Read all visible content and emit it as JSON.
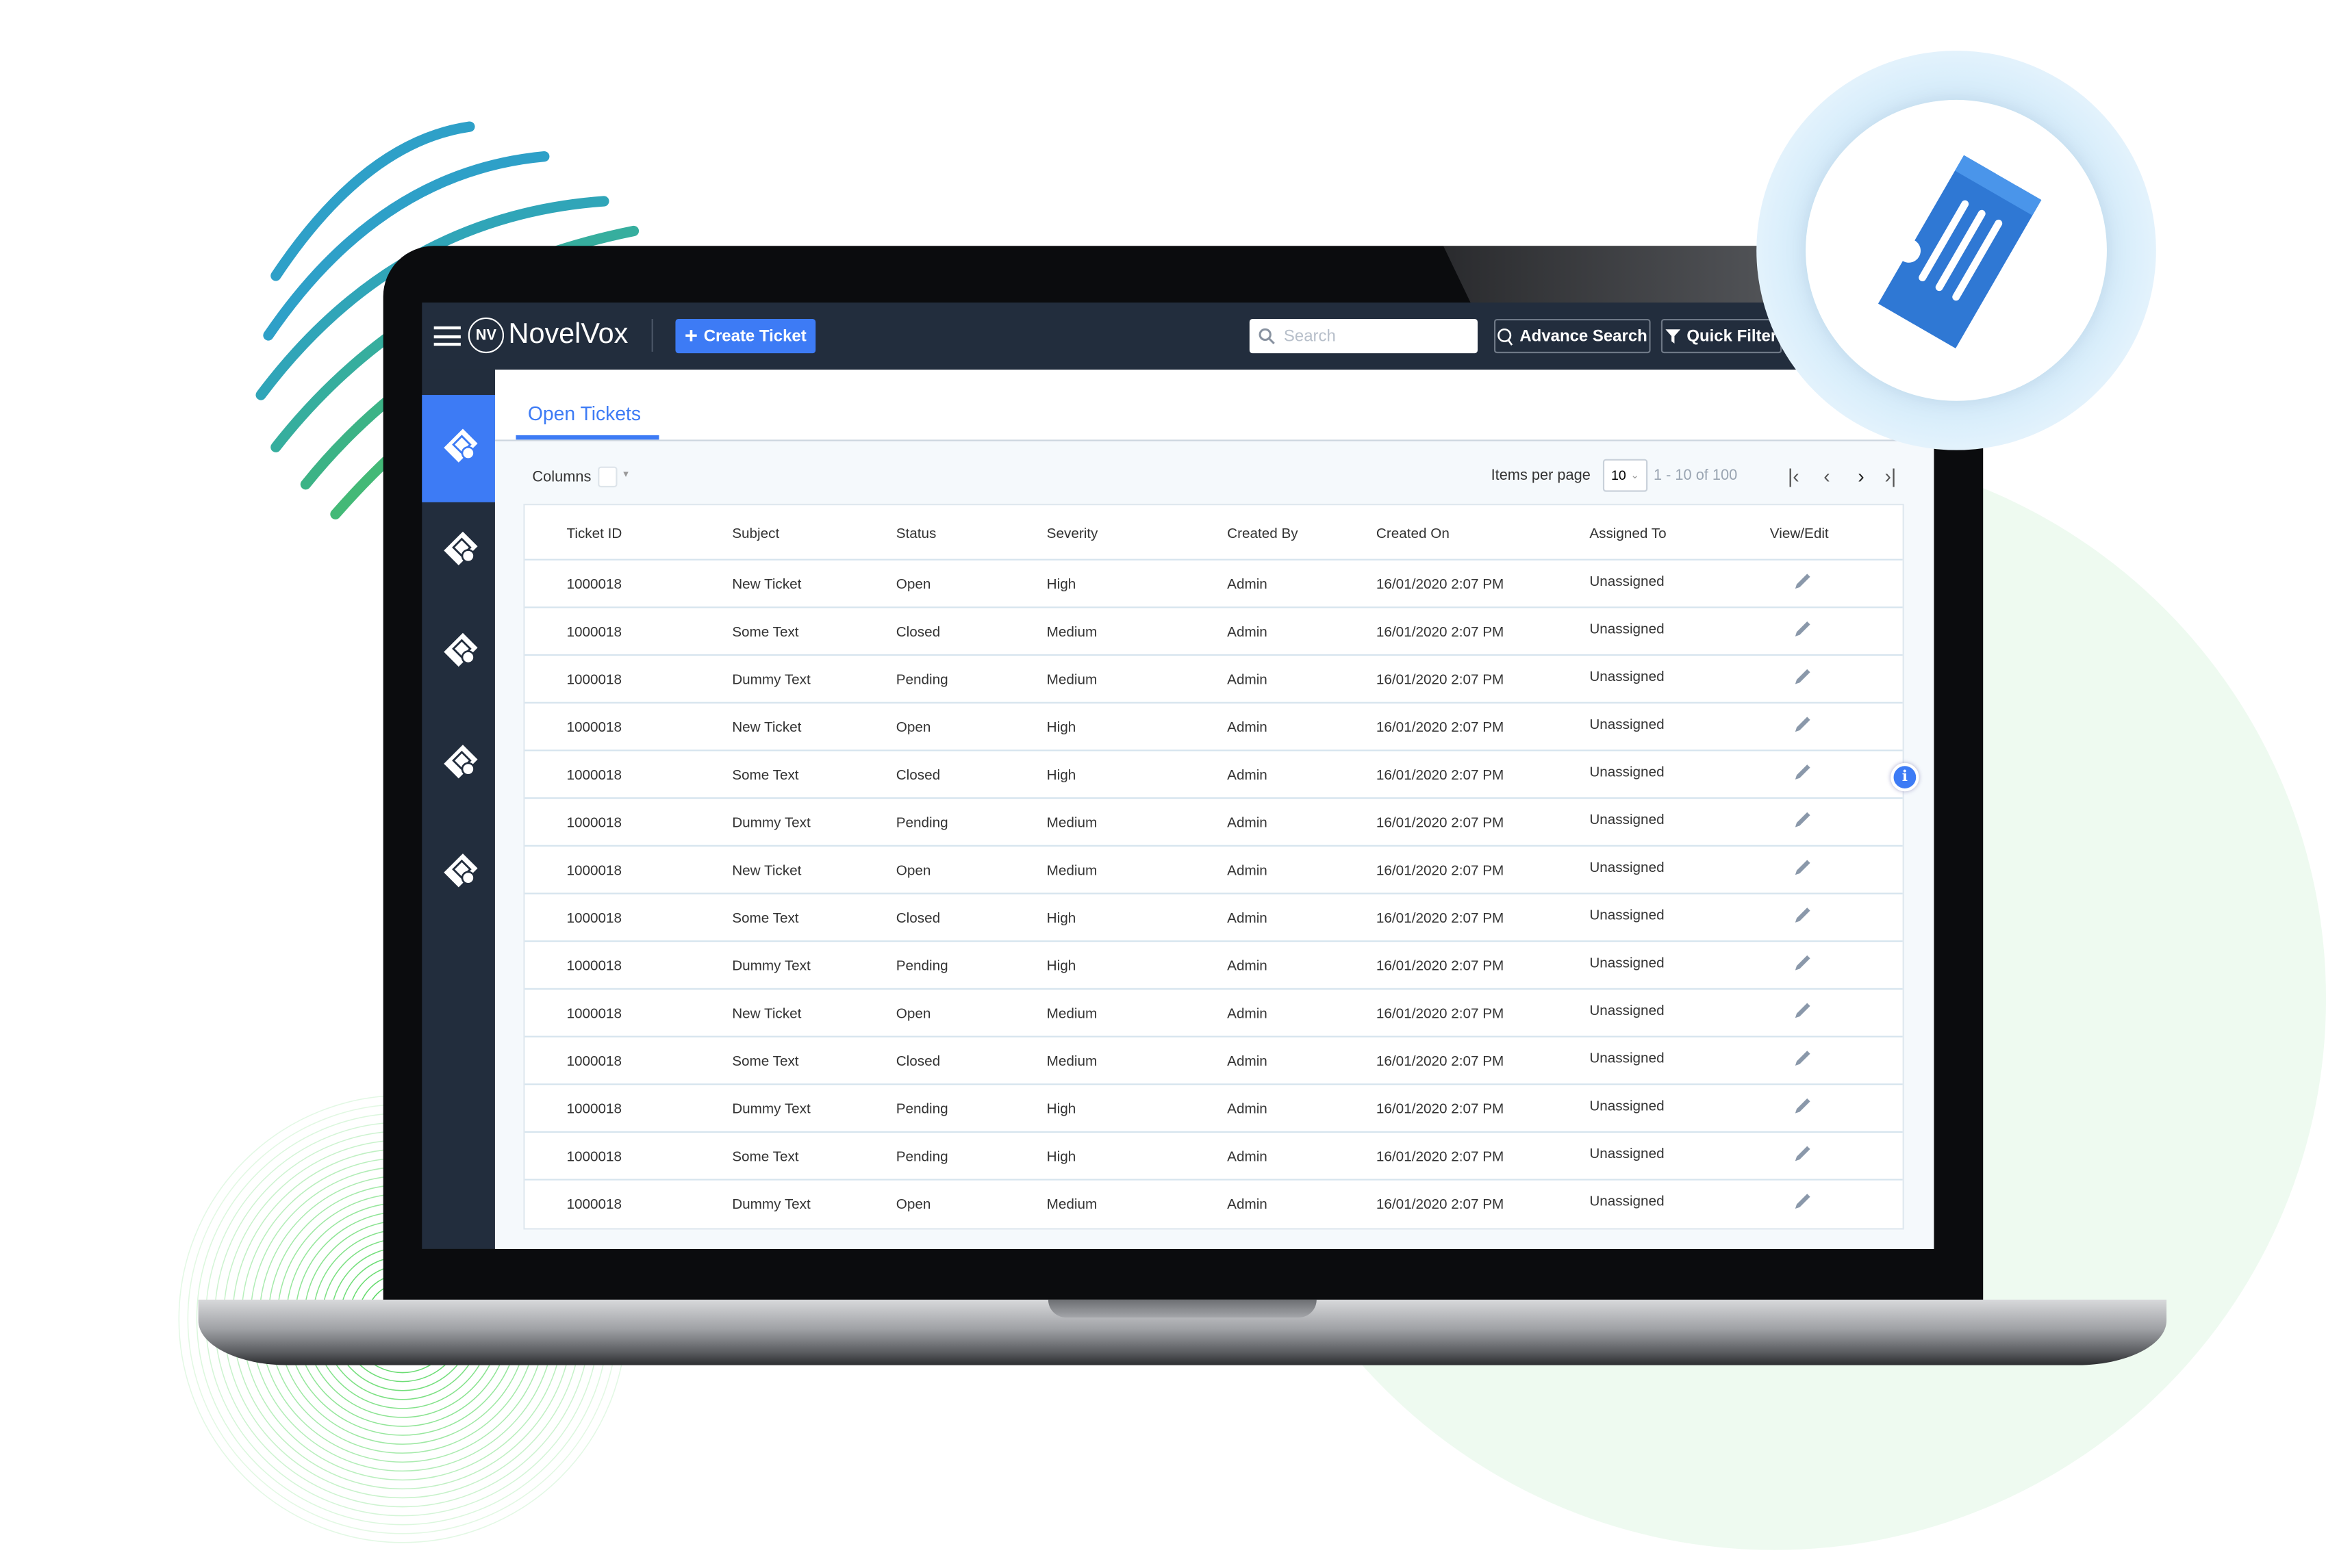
{
  "app": {
    "brand": "NovelVox",
    "logo_text": "NV",
    "create_ticket": "Create Ticket",
    "search_placeholder": "Search",
    "advance_search": "Advance Search",
    "quick_filter": "Quick Filter"
  },
  "tabs": [
    {
      "label": "Open Tickets",
      "active": true
    }
  ],
  "toolbar": {
    "columns_label": "Columns",
    "items_per_page_label": "Items per page",
    "items_per_page_value": "10",
    "range": "1 - 10 of 100"
  },
  "table": {
    "headers": [
      "Ticket ID",
      "Subject",
      "Status",
      "Severity",
      "Created By",
      "Created On",
      "Assigned To",
      "View/Edit"
    ],
    "rows": [
      [
        "1000018",
        "New Ticket",
        "Open",
        "High",
        "Admin",
        "16/01/2020 2:07 PM",
        "Unassigned"
      ],
      [
        "1000018",
        "Some Text",
        "Closed",
        "Medium",
        "Admin",
        "16/01/2020 2:07 PM",
        "Unassigned"
      ],
      [
        "1000018",
        "Dummy Text",
        "Pending",
        "Medium",
        "Admin",
        "16/01/2020 2:07 PM",
        "Unassigned"
      ],
      [
        "1000018",
        "New Ticket",
        "Open",
        "High",
        "Admin",
        "16/01/2020 2:07 PM",
        "Unassigned"
      ],
      [
        "1000018",
        "Some Text",
        "Closed",
        "High",
        "Admin",
        "16/01/2020 2:07 PM",
        "Unassigned"
      ],
      [
        "1000018",
        "Dummy Text",
        "Pending",
        "Medium",
        "Admin",
        "16/01/2020 2:07 PM",
        "Unassigned"
      ],
      [
        "1000018",
        "New Ticket",
        "Open",
        "Medium",
        "Admin",
        "16/01/2020 2:07 PM",
        "Unassigned"
      ],
      [
        "1000018",
        "Some Text",
        "Closed",
        "High",
        "Admin",
        "16/01/2020 2:07 PM",
        "Unassigned"
      ],
      [
        "1000018",
        "Dummy Text",
        "Pending",
        "High",
        "Admin",
        "16/01/2020 2:07 PM",
        "Unassigned"
      ],
      [
        "1000018",
        "New Ticket",
        "Open",
        "Medium",
        "Admin",
        "16/01/2020 2:07 PM",
        "Unassigned"
      ],
      [
        "1000018",
        "Some Text",
        "Closed",
        "Medium",
        "Admin",
        "16/01/2020 2:07 PM",
        "Unassigned"
      ],
      [
        "1000018",
        "Dummy Text",
        "Pending",
        "High",
        "Admin",
        "16/01/2020 2:07 PM",
        "Unassigned"
      ],
      [
        "1000018",
        "Some Text",
        "Pending",
        "High",
        "Admin",
        "16/01/2020 2:07 PM",
        "Unassigned"
      ],
      [
        "1000018",
        "Dummy Text",
        "Open",
        "Medium",
        "Admin",
        "16/01/2020 2:07 PM",
        "Unassigned"
      ]
    ]
  },
  "colors": {
    "accent": "#3d7bf5",
    "header_bg": "#222d3d",
    "ticket_icon": "#2f78d4"
  },
  "icons": [
    "hamburger-icon",
    "search-icon",
    "advance-search-icon",
    "filter-icon",
    "ticket-icon",
    "pencil-icon",
    "info-icon"
  ]
}
